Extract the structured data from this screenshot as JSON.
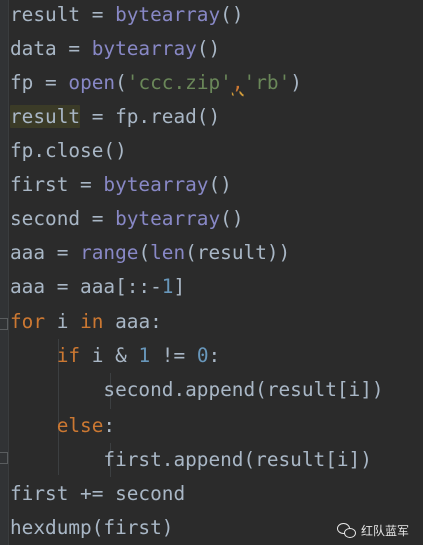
{
  "editor": {
    "lines": [
      {
        "parts": [
          "result",
          " = ",
          "bytearray",
          "()"
        ]
      },
      {
        "parts": [
          "data",
          " = ",
          "bytearray",
          "()"
        ]
      },
      {
        "parts": [
          "fp",
          " = ",
          "open",
          "(",
          "'ccc.zip'",
          ",",
          "'rb'",
          ")"
        ]
      },
      {
        "parts": [
          "result",
          " = fp.read()"
        ]
      },
      {
        "parts": [
          "fp.close()"
        ]
      },
      {
        "parts": [
          "first",
          " = ",
          "bytearray",
          "()"
        ]
      },
      {
        "parts": [
          "second",
          " = ",
          "bytearray",
          "()"
        ]
      },
      {
        "parts": [
          "aaa",
          " = ",
          "range",
          "(",
          "len",
          "(result))"
        ]
      },
      {
        "parts": [
          "aaa",
          " = aaa[::-",
          "1",
          "]"
        ]
      },
      {
        "parts": [
          "for",
          " i ",
          "in",
          " aaa:"
        ]
      },
      {
        "parts": [
          "    ",
          "if",
          " i & ",
          "1",
          " != ",
          "0",
          ":"
        ]
      },
      {
        "parts": [
          "        second.append(result[i])"
        ]
      },
      {
        "parts": [
          "    ",
          "else",
          ":"
        ]
      },
      {
        "parts": [
          "        first.append(result[i])"
        ]
      },
      {
        "parts": [
          "first += second"
        ]
      },
      {
        "parts": [
          "hexdump(first)"
        ]
      }
    ]
  },
  "watermark": {
    "text": "红队蓝军",
    "icon": "wechat-icon"
  }
}
